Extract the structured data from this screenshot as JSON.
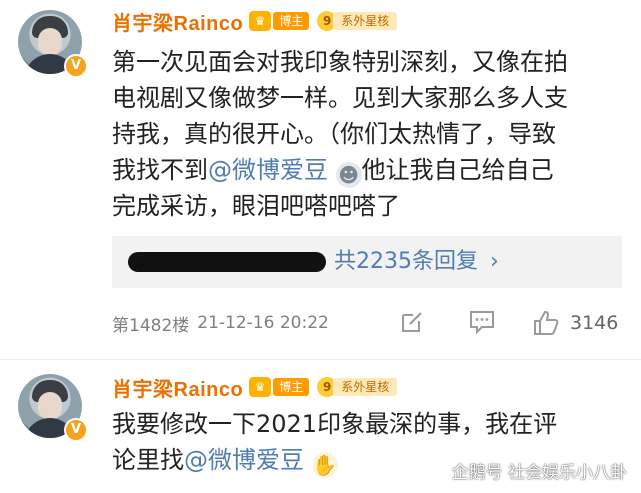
{
  "post1": {
    "username": "肖宇梁Rainco",
    "blogger_tag": "博主",
    "level_num": "9",
    "star_tag": "系外星核",
    "verified_mark": "V",
    "line1": "第一次见面会对我印象特别深刻，又像在拍",
    "line2": "电视剧又像做梦一样。见到大家那么多人支",
    "line3": "持我，真的很开心。（你们太热情了，导致",
    "line4_prefix": "我找不到",
    "mention": "@微博爱豆",
    "line4_suffix": "他让我自己给自己",
    "line5": "完成采访，眼泪吧嗒吧嗒了",
    "reply_summary": "共2235条回复",
    "reply_chevron": "›",
    "floor": "第1482楼",
    "time": "21-12-16 20:22",
    "like_count": "3146"
  },
  "post2": {
    "username": "肖宇梁Rainco",
    "blogger_tag": "博主",
    "level_num": "9",
    "star_tag": "系外星核",
    "verified_mark": "V",
    "line1": "我要修改一下2021印象最深的事，我在评",
    "line2_prefix": "论里找",
    "mention": "@微博爱豆"
  },
  "watermark": "企鹅号 社会娱乐小八卦",
  "icons": {
    "share": "share-edit-icon",
    "comment": "comment-icon",
    "like": "thumbs-up-icon",
    "emoji_robot": "robot-emoji-icon",
    "emoji_hands": "praying-hands-emoji-icon"
  },
  "colors": {
    "username": "#ea7000",
    "mention": "#507daf",
    "meta": "#808080"
  }
}
